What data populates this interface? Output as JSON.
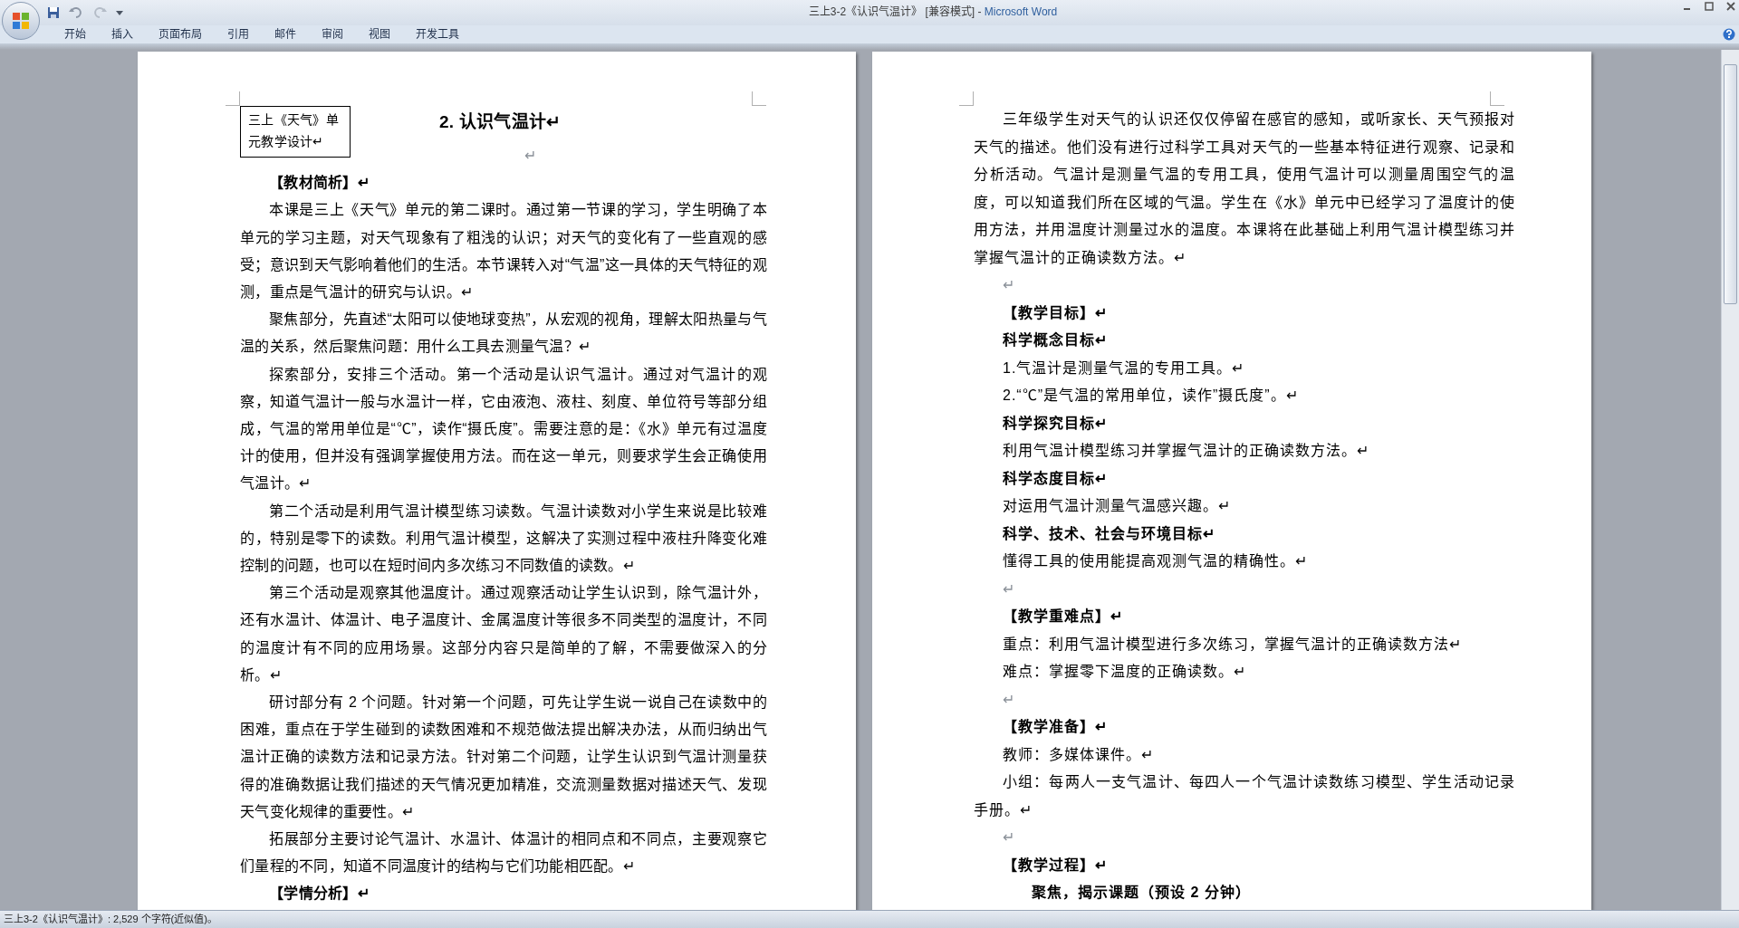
{
  "window": {
    "document_title": "三上3-2《认识气温计》 [兼容模式] - ",
    "app_name": "Microsoft Word"
  },
  "ribbon_tabs": [
    "开始",
    "插入",
    "页面布局",
    "引用",
    "邮件",
    "审阅",
    "视图",
    "开发工具"
  ],
  "pages": [
    {
      "text_box": "三上《天气》单元教学设计↵",
      "title": "2. 认识气温计↵",
      "blocks": [
        {
          "kind": "centered_empty",
          "text": "↵"
        },
        {
          "kind": "heading",
          "text": "【教材简析】↵"
        },
        {
          "kind": "para",
          "text": "本课是三上《天气》单元的第二课时。通过第一节课的学习，学生明确了本单元的学习主题，对天气现象有了粗浅的认识；对天气的变化有了一些直观的感受；意识到天气影响着他们的生活。本节课转入对“气温”这一具体的天气特征的观测，重点是气温计的研究与认识。↵"
        },
        {
          "kind": "para",
          "text": "聚焦部分，先直述“太阳可以使地球变热”，从宏观的视角，理解太阳热量与气温的关系，然后聚焦问题：用什么工具去测量气温？↵"
        },
        {
          "kind": "para",
          "text": "探索部分，安排三个活动。第一个活动是认识气温计。通过对气温计的观察，知道气温计一般与水温计一样，它由液泡、液柱、刻度、单位符号等部分组成，气温的常用单位是“℃”，读作“摄氏度”。需要注意的是：《水》单元有过温度计的使用，但并没有强调掌握使用方法。而在这一单元，则要求学生会正确使用气温计。↵"
        },
        {
          "kind": "para",
          "text": "第二个活动是利用气温计模型练习读数。气温计读数对小学生来说是比较难的，特别是零下的读数。利用气温计模型，这解决了实测过程中液柱升降变化难控制的问题，也可以在短时间内多次练习不同数值的读数。↵"
        },
        {
          "kind": "para",
          "text": "第三个活动是观察其他温度计。通过观察活动让学生认识到，除气温计外，还有水温计、体温计、电子温度计、金属温度计等很多不同类型的温度计，不同的温度计有不同的应用场景。这部分内容只是简单的了解，不需要做深入的分析。↵"
        },
        {
          "kind": "para",
          "text": "研讨部分有 2 个问题。针对第一个问题，可先让学生说一说自己在读数中的困难，重点在于学生碰到的读数困难和不规范做法提出解决办法，从而归纳出气温计正确的读数方法和记录方法。针对第二个问题，让学生认识到气温计测量获得的准确数据让我们描述的天气情况更加精准，交流测量数据对描述天气、发现天气变化规律的重要性。↵"
        },
        {
          "kind": "para",
          "text": "拓展部分主要讨论气温计、水温计、体温计的相同点和不同点，主要观察它们量程的不同，知道不同温度计的结构与它们功能相匹配。↵"
        },
        {
          "kind": "heading",
          "text": "【学情分析】↵"
        }
      ]
    },
    {
      "blocks": [
        {
          "kind": "para",
          "text": "三年级学生对天气的认识还仅仅停留在感官的感知，或听家长、天气预报对天气的描述。他们没有进行过科学工具对天气的一些基本特征进行观察、记录和分析活动。气温计是测量气温的专用工具，使用气温计可以测量周围空气的温度，可以知道我们所在区域的气温。学生在《水》单元中已经学习了温度计的使用方法，并用温度计测量过水的温度。本课将在此基础上利用气温计模型练习并掌握气温计的正确读数方法。↵"
        },
        {
          "kind": "empty",
          "text": "↵"
        },
        {
          "kind": "heading",
          "text": "【教学目标】↵"
        },
        {
          "kind": "heading",
          "text": "科学概念目标↵"
        },
        {
          "kind": "para",
          "text": "1.气温计是测量气温的专用工具。↵"
        },
        {
          "kind": "para",
          "text": "2.“℃”是气温的常用单位，读作”摄氏度”。↵"
        },
        {
          "kind": "heading",
          "text": "科学探究目标↵"
        },
        {
          "kind": "para",
          "text": "利用气温计模型练习并掌握气温计的正确读数方法。↵"
        },
        {
          "kind": "heading",
          "text": "科学态度目标↵"
        },
        {
          "kind": "para",
          "text": "对运用气温计测量气温感兴趣。↵"
        },
        {
          "kind": "heading",
          "text": "科学、技术、社会与环境目标↵"
        },
        {
          "kind": "para",
          "text": "懂得工具的使用能提高观测气温的精确性。↵"
        },
        {
          "kind": "empty",
          "text": "↵"
        },
        {
          "kind": "heading",
          "text": "【教学重难点】↵"
        },
        {
          "kind": "para",
          "text": "重点：利用气温计模型进行多次练习，掌握气温计的正确读数方法↵"
        },
        {
          "kind": "para",
          "text": "难点：掌握零下温度的正确读数。↵"
        },
        {
          "kind": "empty",
          "text": "↵"
        },
        {
          "kind": "heading",
          "text": "【教学准备】↵"
        },
        {
          "kind": "para",
          "text": "教师：多媒体课件。↵"
        },
        {
          "kind": "para",
          "text": "小组：每两人一支气温计、每四人一个气温计读数练习模型、学生活动记录手册。↵"
        },
        {
          "kind": "empty",
          "text": "↵"
        },
        {
          "kind": "heading",
          "text": "【教学过程】↵"
        },
        {
          "kind": "step",
          "text": "聚焦，揭示课题（预设 2 分钟）"
        }
      ]
    }
  ],
  "status_bar": "三上3-2《认识气温计》: 2,529 个字符(近似值)。"
}
